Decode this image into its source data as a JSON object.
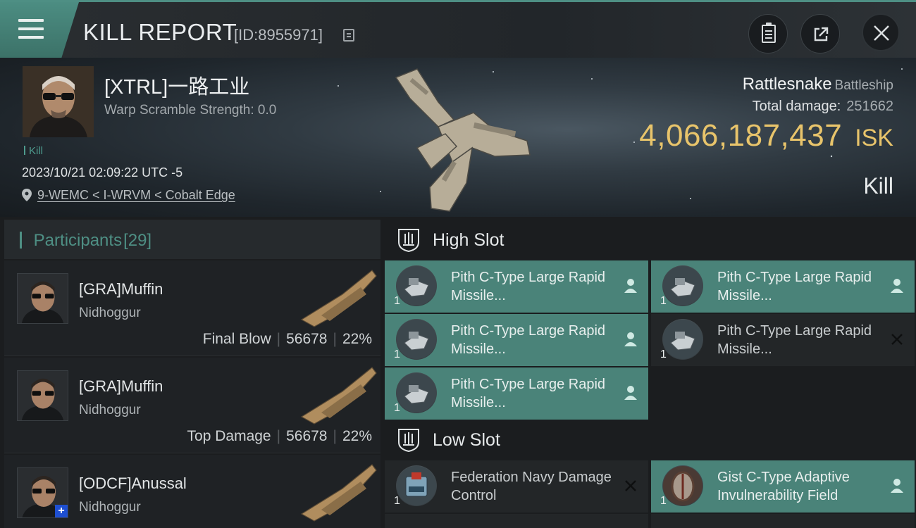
{
  "header": {
    "title": "KILL REPORT",
    "kill_id": "[ID:8955971]"
  },
  "victim": {
    "pilot": "[XTRL]一路工业",
    "warp_scramble": "Warp Scramble Strength: 0.0",
    "tag": "Kill",
    "timestamp": "2023/10/21 02:09:22 UTC -5",
    "location": "9-WEMC < I-WRVM < Cobalt Edge",
    "ship_name": "Rattlesnake",
    "ship_class": "Battleship",
    "total_damage_label": "Total damage:",
    "total_damage": "251662",
    "isk_value": "4,066,187,437",
    "isk_unit": "ISK",
    "result": "Kill"
  },
  "participants": {
    "label": "Participants",
    "count": "[29]",
    "rows": [
      {
        "name": "[GRA]Muffin",
        "ship": "Nidhoggur",
        "role": "Final Blow",
        "damage": "56678",
        "percent": "22%"
      },
      {
        "name": "[GRA]Muffin",
        "ship": "Nidhoggur",
        "role": "Top Damage",
        "damage": "56678",
        "percent": "22%"
      },
      {
        "name": "[ODCF]Anussal",
        "ship": "Nidhoggur"
      }
    ]
  },
  "fitting": {
    "high_slot_label": "High Slot",
    "low_slot_label": "Low Slot",
    "high_slot": [
      {
        "name": "Pith C-Type Large Rapid Missile...",
        "qty": "1",
        "status": "dropped"
      },
      {
        "name": "Pith C-Type Large Rapid Missile...",
        "qty": "1",
        "status": "dropped"
      },
      {
        "name": "Pith C-Type Large Rapid Missile...",
        "qty": "1",
        "status": "dropped"
      },
      {
        "name": "Pith C-Type Large Rapid Missile...",
        "qty": "1",
        "status": "destroyed"
      },
      {
        "name": "Pith C-Type Large Rapid Missile...",
        "qty": "1",
        "status": "dropped"
      }
    ],
    "low_slot": [
      {
        "name": "Federation Navy Damage Control",
        "qty": "1",
        "status": "destroyed"
      },
      {
        "name": "Gist C-Type Adaptive Invulnerability Field",
        "qty": "1",
        "status": "dropped"
      }
    ]
  },
  "colors": {
    "accent": "#4e8f84",
    "module_dropped": "#4a8379",
    "isk": "#e8c46b"
  }
}
